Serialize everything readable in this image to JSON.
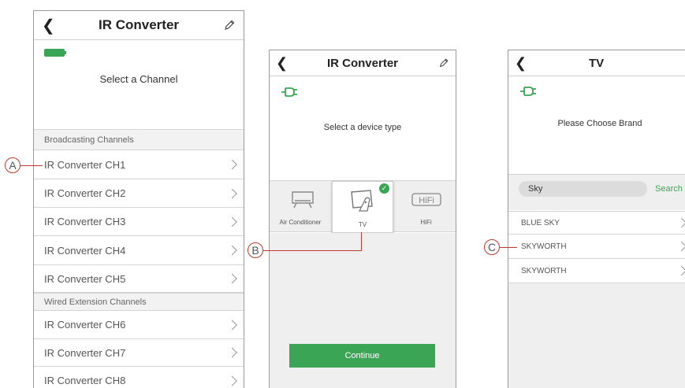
{
  "screen1": {
    "title": "IR Converter",
    "prompt": "Select a Channel",
    "section_broadcast": "Broadcasting Channels",
    "section_wired": "Wired Extension Channels",
    "channels": [
      "IR Converter CH1",
      "IR Converter CH2",
      "IR Converter CH3",
      "IR Converter CH4",
      "IR Converter CH5",
      "IR Converter CH6",
      "IR Converter CH7",
      "IR Converter CH8"
    ],
    "callout": "A"
  },
  "screen2": {
    "title": "IR Converter",
    "prompt": "Select a device type",
    "devices": [
      "Air Conditioner",
      "TV",
      "HiFi"
    ],
    "selected_device": "TV",
    "continue_label": "Continue",
    "callout": "B"
  },
  "screen3": {
    "title": "TV",
    "prompt": "Please Choose Brand",
    "search_value": "Sky",
    "search_label": "Search",
    "brands": [
      "BLUE SKY",
      "SKYWORTH",
      "SKYWORTH"
    ],
    "callout": "C"
  },
  "colors": {
    "accent_green": "#3aa655",
    "callout_red": "#c0392b"
  }
}
